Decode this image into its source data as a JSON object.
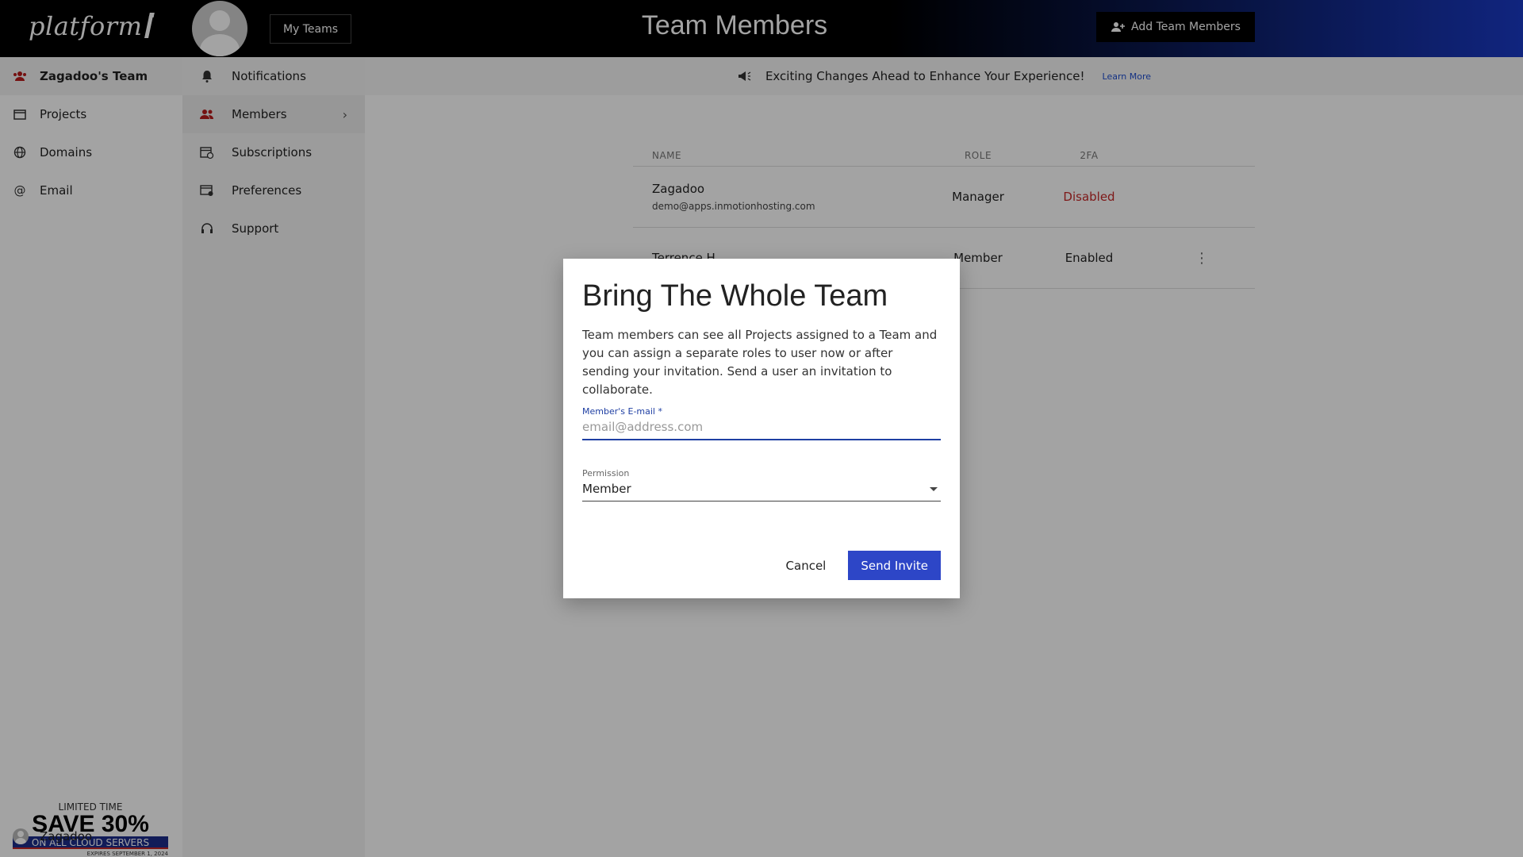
{
  "brand": {
    "logo_text": "platform"
  },
  "header": {
    "my_teams_label": "My Teams",
    "title": "Team Members",
    "add_button_label": "Add Team Members"
  },
  "left_nav": {
    "items": [
      {
        "label": "Zagadoo's Team",
        "icon": "team-icon"
      },
      {
        "label": "Projects",
        "icon": "projects-icon"
      },
      {
        "label": "Domains",
        "icon": "globe-icon"
      },
      {
        "label": "Email",
        "icon": "at-icon"
      }
    ]
  },
  "sub_nav": {
    "items": [
      {
        "label": "Notifications",
        "icon": "bell-icon"
      },
      {
        "label": "Members",
        "icon": "members-icon"
      },
      {
        "label": "Subscriptions",
        "icon": "calendar-icon"
      },
      {
        "label": "Preferences",
        "icon": "preferences-icon"
      },
      {
        "label": "Support",
        "icon": "headset-icon"
      }
    ]
  },
  "notice": {
    "text": "Exciting Changes Ahead to Enhance Your Experience!",
    "link": "Learn More"
  },
  "table": {
    "headers": {
      "name": "NAME",
      "role": "ROLE",
      "twofa": "2FA"
    },
    "rows": [
      {
        "name": "Zagadoo",
        "email": "demo@apps.inmotionhosting.com",
        "role": "Manager",
        "twofa": "Disabled"
      },
      {
        "name": "Terrence H",
        "email": "",
        "role": "Member",
        "twofa": "Enabled"
      }
    ]
  },
  "promo": {
    "line1": "LIMITED TIME",
    "line2": "SAVE 30%",
    "line3": "ON ALL CLOUD SERVERS",
    "line4": "EXPIRES SEPTEMBER 1, 2024"
  },
  "user": {
    "name": "Zagadoo"
  },
  "dialog": {
    "title": "Bring The Whole Team",
    "body": "Team members can see all Projects assigned to a Team and you can assign a separate roles to user now or after sending your invitation. Send a user an invitation to collaborate.",
    "email_label": "Member's E-mail *",
    "email_placeholder": "email@address.com",
    "email_value": "",
    "permission_label": "Permission",
    "permission_value": "Member",
    "cancel_label": "Cancel",
    "send_label": "Send Invite"
  },
  "colors": {
    "accent": "#2d46c7",
    "danger": "#c62828",
    "topbar": "#000000"
  }
}
